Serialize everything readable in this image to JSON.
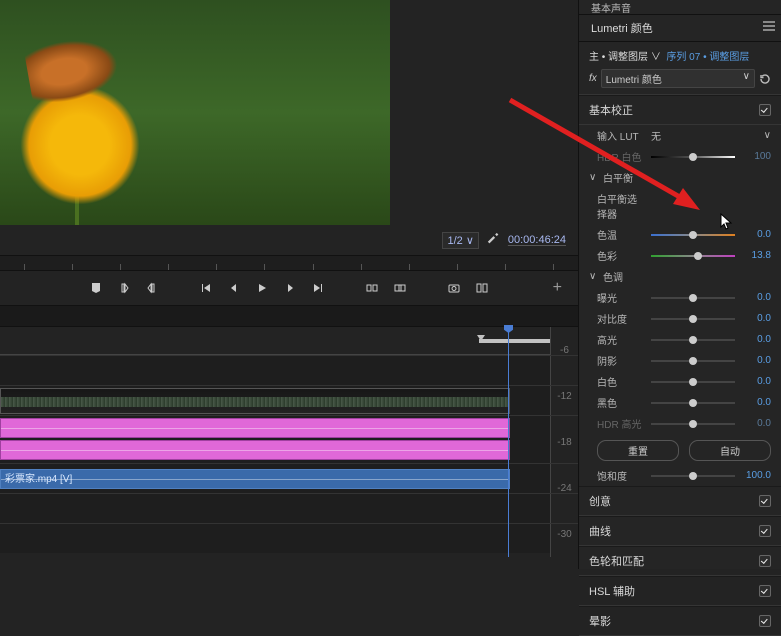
{
  "preview": {
    "zoom": "1/2",
    "timecode": "00:00:46:24"
  },
  "timeline": {
    "scale_marks": [
      "-6",
      "-12",
      "-18",
      "-24",
      "-30"
    ],
    "video_clip_label": "彩票家.mp4 [V]"
  },
  "right": {
    "top_tab": "基本声音",
    "title": "Lumetri 颜色",
    "source_prefix": "主 • 调整图层",
    "source_arrow": "∨",
    "sequence": "序列 07 • 调整图层",
    "fx_label": "fx",
    "fx_select": "Lumetri 颜色",
    "basic_correct": "基本校正",
    "input_lut": "输入 LUT",
    "input_lut_val": "无",
    "hdr_white": "HDR 白色",
    "hdr_white_val": "100",
    "white_balance": "白平衡",
    "wb_picker": "白平衡选择器",
    "temperature": "色温",
    "temperature_val": "0.0",
    "tint": "色彩",
    "tint_val": "13.8",
    "tone": "色调",
    "exposure": "曝光",
    "exposure_val": "0.0",
    "contrast": "对比度",
    "contrast_val": "0.0",
    "highlights": "高光",
    "highlights_val": "0.0",
    "shadows": "阴影",
    "shadows_val": "0.0",
    "whites": "白色",
    "whites_val": "0.0",
    "blacks": "黑色",
    "blacks_val": "0.0",
    "hdr_highlight": "HDR 高光",
    "hdr_highlight_val": "0.0",
    "reset_btn": "重置",
    "auto_btn": "自动",
    "saturation": "饱和度",
    "saturation_val": "100.0",
    "creative": "创意",
    "curves": "曲线",
    "wheels": "色轮和匹配",
    "hsl": "HSL 辅助",
    "vignette": "晕影"
  }
}
